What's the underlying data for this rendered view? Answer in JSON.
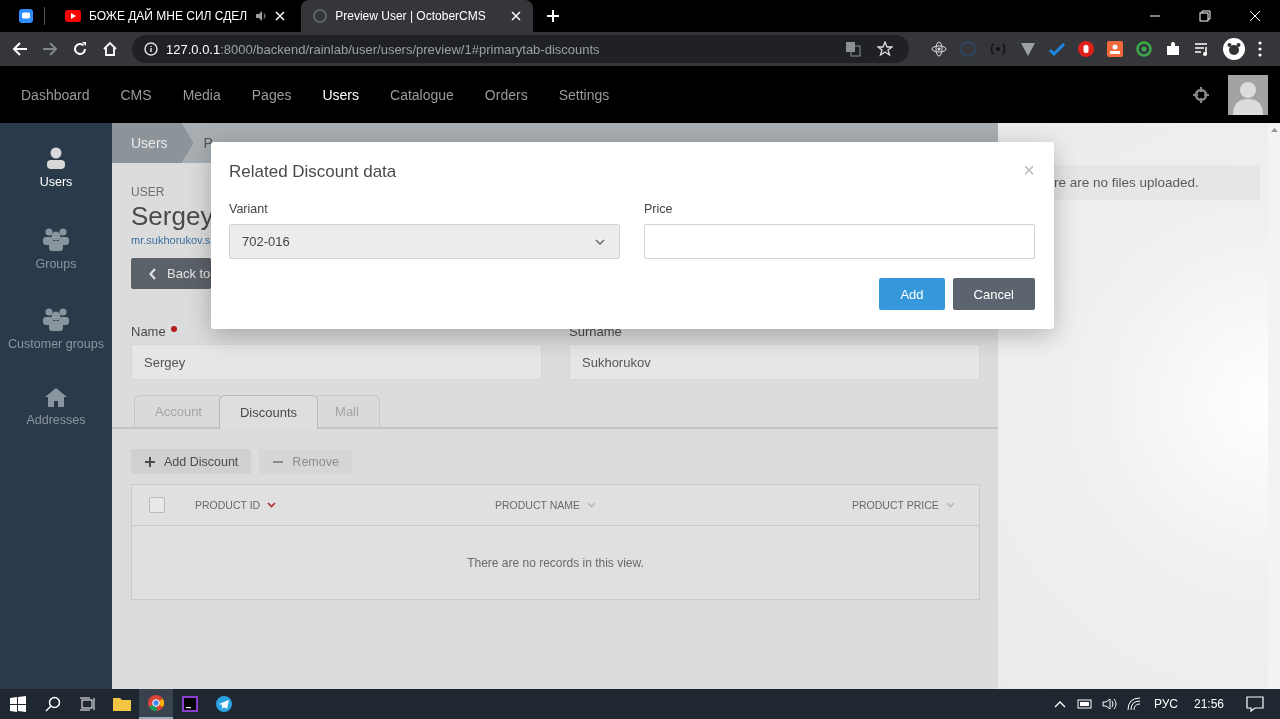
{
  "browser": {
    "tabs": [
      {
        "title": "БОЖЕ ДАЙ МНЕ СИЛ СДЕЛ",
        "selected": false,
        "audio": true
      },
      {
        "title": "Preview User | OctoberCMS",
        "selected": true,
        "audio": false
      }
    ],
    "url_host": "127.0.0.1",
    "url_rest": ":8000/backend/rainlab/user/users/preview/1#primarytab-discounts"
  },
  "nav": {
    "items": [
      {
        "label": "Dashboard",
        "selected": false
      },
      {
        "label": "CMS",
        "selected": false
      },
      {
        "label": "Media",
        "selected": false
      },
      {
        "label": "Pages",
        "selected": false
      },
      {
        "label": "Users",
        "selected": true
      },
      {
        "label": "Catalogue",
        "selected": false
      },
      {
        "label": "Orders",
        "selected": false
      },
      {
        "label": "Settings",
        "selected": false
      }
    ]
  },
  "sidebar": {
    "items": [
      {
        "label": "Users",
        "selected": true
      },
      {
        "label": "Groups",
        "selected": false
      },
      {
        "label": "Customer groups",
        "selected": false
      },
      {
        "label": "Addresses",
        "selected": false
      }
    ]
  },
  "breadcrumb": [
    "Users",
    "P"
  ],
  "user": {
    "eyebrow": "USER",
    "name": "Sergey",
    "email": "mr.sukhorukov.s",
    "back_button": "Back to"
  },
  "fields": [
    {
      "label": "Name",
      "required": true,
      "value": "Sergey"
    },
    {
      "label": "Surname",
      "required": false,
      "value": "Sukhorukov"
    }
  ],
  "tabs": [
    {
      "label": "Account",
      "selected": false
    },
    {
      "label": "Discounts",
      "selected": true
    },
    {
      "label": "Mall",
      "selected": false
    }
  ],
  "toolbar": [
    {
      "label": "Add Discount",
      "disabled": false
    },
    {
      "label": "Remove",
      "disabled": true
    }
  ],
  "table": {
    "columns": [
      {
        "label": "PRODUCT ID",
        "sorted": true
      },
      {
        "label": "PRODUCT NAME",
        "sorted": false
      },
      {
        "label": "PRODUCT PRICE",
        "sorted": false
      }
    ],
    "select_all_checked": false,
    "empty_message": "There are no records in this view."
  },
  "files_panel": {
    "message": "re are no files uploaded."
  },
  "modal": {
    "title": "Related Discount data",
    "close": "×",
    "fields": [
      {
        "kind": "select",
        "label": "Variant",
        "value": "702-016"
      },
      {
        "kind": "text",
        "label": "Price"
      }
    ],
    "buttons": [
      {
        "label": "Add",
        "kind": "primary"
      },
      {
        "label": "Cancel",
        "kind": "secondary"
      }
    ]
  },
  "taskbar": {
    "apps": [
      {
        "selected": false
      },
      {
        "selected": true
      },
      {
        "selected": false
      },
      {
        "selected": false
      }
    ],
    "language": "РУС",
    "time": "21:56"
  }
}
